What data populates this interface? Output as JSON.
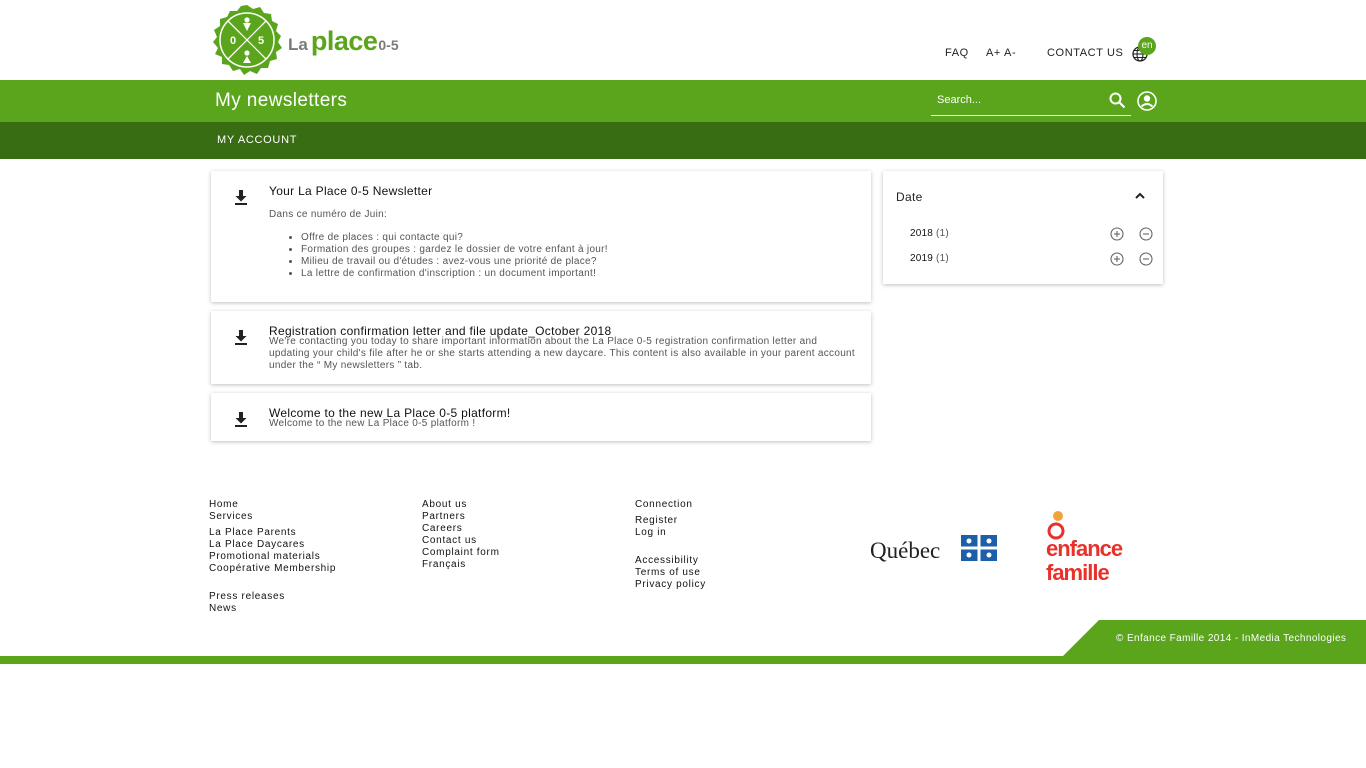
{
  "brand": {
    "la": "La",
    "place": "place",
    "age": "0-5",
    "badge_left": "0",
    "badge_right": "5",
    "accent": "#5aa51c",
    "dark_accent": "#386d14"
  },
  "toplinks": {
    "faq": "FAQ",
    "text_size": "A+ A-",
    "contact": "CONTACT US",
    "lang_badge": "en"
  },
  "titlebar": {
    "title": "My newsletters",
    "search_placeholder": "Search..."
  },
  "nav": {
    "my_account": "MY ACCOUNT"
  },
  "newsletters": [
    {
      "title": "Your La Place 0-5 Newsletter",
      "intro": "Dans ce numéro de Juin:",
      "bullets": [
        "Offre de places : qui contacte qui?",
        "Formation des groupes : gardez le dossier de votre enfant à jour!",
        "Milieu de travail ou d'études : avez-vous une priorité de place?",
        "La lettre de confirmation d'inscription : un document important!"
      ]
    },
    {
      "title": "Registration confirmation letter and file update_October 2018",
      "description": "We're contacting you today to share important information about the La Place 0-5 registration confirmation letter and updating your child's file after he or she starts attending a new daycare. This content is also available in your parent account under the “ My newsletters ” tab."
    },
    {
      "title": "Welcome to the new La Place 0-5 platform!",
      "description": "Welcome to the new La Place 0-5 platform !"
    }
  ],
  "filter": {
    "title": "Date",
    "options": [
      {
        "year": "2018",
        "count": "(1)"
      },
      {
        "year": "2019",
        "count": "(1)"
      }
    ]
  },
  "footer": {
    "col1": [
      "Home",
      "Services",
      "La Place Parents",
      "La Place Daycares",
      "Promotional materials",
      "Coopérative Membership",
      "Press releases",
      "News"
    ],
    "col2": [
      "About us",
      "Partners",
      "Careers",
      "Contact us",
      "Complaint form",
      "Français"
    ],
    "col3": [
      "Connection",
      "Register",
      "Log in",
      "Accessibility",
      "Terms of use",
      "Privacy policy"
    ],
    "quebec_logo": "Québec",
    "ef_logo": {
      "line1": "enfance",
      "line2": "famille"
    },
    "copyright": "© Enfance Famille 2014 - InMedia Technologies"
  }
}
